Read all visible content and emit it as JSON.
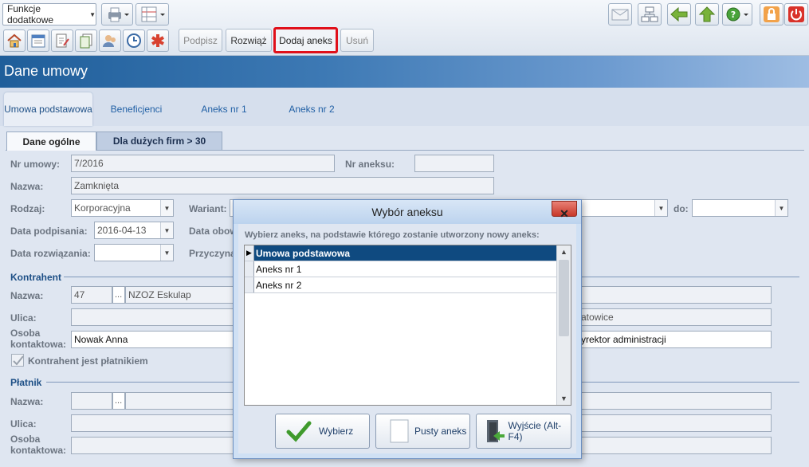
{
  "toolbar": {
    "functions_combo": "Funkcje dodatkowe",
    "actions": [
      {
        "label": "Podpisz",
        "enabled": false
      },
      {
        "label": "Rozwiąż",
        "enabled": true
      },
      {
        "label": "Dodaj aneks",
        "enabled": true,
        "highlighted": true
      },
      {
        "label": "Usuń",
        "enabled": false
      }
    ]
  },
  "header": {
    "title": "Dane umowy"
  },
  "main_tabs": [
    {
      "label": "Umowa podstawowa",
      "active": true
    },
    {
      "label": "Beneficjenci"
    },
    {
      "label": "Aneks nr 1"
    },
    {
      "label": "Aneks nr 2"
    }
  ],
  "sub_tabs": [
    {
      "label": "Dane ogólne",
      "active": true
    },
    {
      "label": "Dla dużych firm > 30"
    }
  ],
  "form": {
    "nr_umowy_label": "Nr umowy:",
    "nr_umowy": "7/2016",
    "nr_aneksu_label": "Nr aneksu:",
    "nr_aneksu": "",
    "nazwa_label": "Nazwa:",
    "nazwa": "Zamknięta",
    "rodzaj_label": "Rodzaj:",
    "rodzaj": "Korporacyjna",
    "wariant_label": "Wariant:",
    "do_label": "do:",
    "data_podpisania_label": "Data podpisania:",
    "data_podpisania": "2016-04-13",
    "data_obow_label": "Data obow",
    "data_rozwiazania_label": "Data rozwiązania:",
    "przyczyna_label": "Przyczyna",
    "kontrahent_section": "Kontrahent",
    "kontrahent_nazwa_label": "Nazwa:",
    "kontrahent_id": "47",
    "kontrahent_ellipsis": "...",
    "kontrahent_nazwa": "NZOZ Eskulap",
    "ulica_label": "Ulica:",
    "ulica_right": "atowice",
    "osoba_label_1": "Osoba",
    "osoba_label_2": "kontaktowa:",
    "osoba": "Nowak Anna",
    "stanowisko": "yrektor administracji",
    "platnik_checkbox": "Kontrahent jest płatnikiem",
    "platnik_section": "Płatnik",
    "platnik_nazwa_label": "Nazwa:",
    "platnik_ellipsis": "...",
    "platnik_ulica_label": "Ulica:",
    "platnik_osoba_label_1": "Osoba",
    "platnik_osoba_label_2": "kontaktowa:"
  },
  "modal": {
    "title": "Wybór aneksu",
    "close": "✕",
    "instruction": "Wybierz aneks, na podstawie którego zostanie utworzony nowy aneks:",
    "rows": [
      "Umowa podstawowa",
      "Aneks nr 1",
      "Aneks nr 2"
    ],
    "buttons": {
      "select": "Wybierz",
      "empty": "Pusty aneks",
      "exit": "Wyjście (Alt-F4)"
    }
  },
  "colors": {
    "accent": "#1d4f86",
    "highlight_border": "#e0101a",
    "selected_row": "#0f4a80"
  }
}
